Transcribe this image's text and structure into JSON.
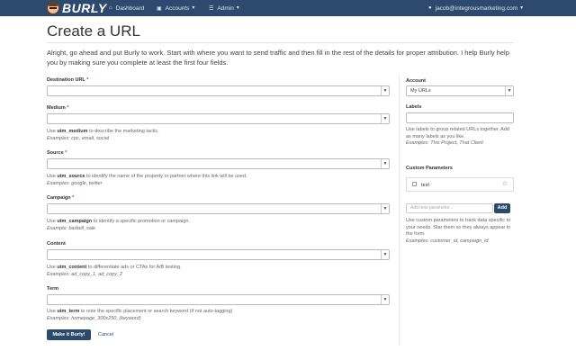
{
  "navbar": {
    "brand": "BURLY",
    "dashboard": "Dashboard",
    "accounts": "Accounts",
    "admin": "Admin",
    "user_email": "jacob@integrousmarketing.com"
  },
  "page": {
    "title": "Create a URL",
    "intro": "Alright, go ahead and put Burly to work. Start with where you want to send traffic and then fill in the rest of the details for proper attribution. I help Burly help you by making sure you complete at least the first four fields."
  },
  "form": {
    "destination": {
      "label": "Destination URL",
      "required": "*"
    },
    "medium": {
      "label": "Medium",
      "required": "*",
      "help_pre": "Use",
      "help_param": "utm_medium",
      "help_post": "to describe the marketing tactic.",
      "examples": "Examples: cpc, email, social"
    },
    "source": {
      "label": "Source",
      "required": "*",
      "help_pre": "Use",
      "help_param": "utm_source",
      "help_post": "to identify the name of the property or partner where this link will be used.",
      "examples": "Examples: google, twitter"
    },
    "campaign": {
      "label": "Campaign",
      "required": "*",
      "help_pre": "Use",
      "help_param": "utm_campaign",
      "help_post": "to identify a specific promotion or campaign.",
      "examples": "Example: barbell_sale"
    },
    "content": {
      "label": "Content",
      "help_pre": "Use",
      "help_param": "utm_content",
      "help_post": "to differentiate ads or CTAs for A/B testing.",
      "examples": "Examples: ad_copy_1, ad_copy_2"
    },
    "term": {
      "label": "Term",
      "help_pre": "Use",
      "help_param": "utm_term",
      "help_post": "to note the specific placement or search keyword (if not auto-tagging)",
      "examples": "Examples: homepage_300x250, {keyword}"
    },
    "submit_label": "Make it Burly!",
    "cancel_label": "Cancel"
  },
  "sidebar": {
    "account_label": "Account",
    "account_value": "My URLs",
    "labels_label": "Labels",
    "labels_help": "Use labels to group related URLs together. Add as many labels as you like.",
    "labels_examples": "Examples: This Project, That Client",
    "custom_label": "Custom Parameters",
    "param_name": "test",
    "param_placeholder": "Add new parameter...",
    "add_label": "Add",
    "custom_help": "Use custom parameters to track data specific to your needs. Star them so they always appear in the form.",
    "custom_examples": "Examples: customer_id, campaign_id"
  },
  "colors": {
    "navbar": "#2c4a6e",
    "required": "#c0392b"
  }
}
